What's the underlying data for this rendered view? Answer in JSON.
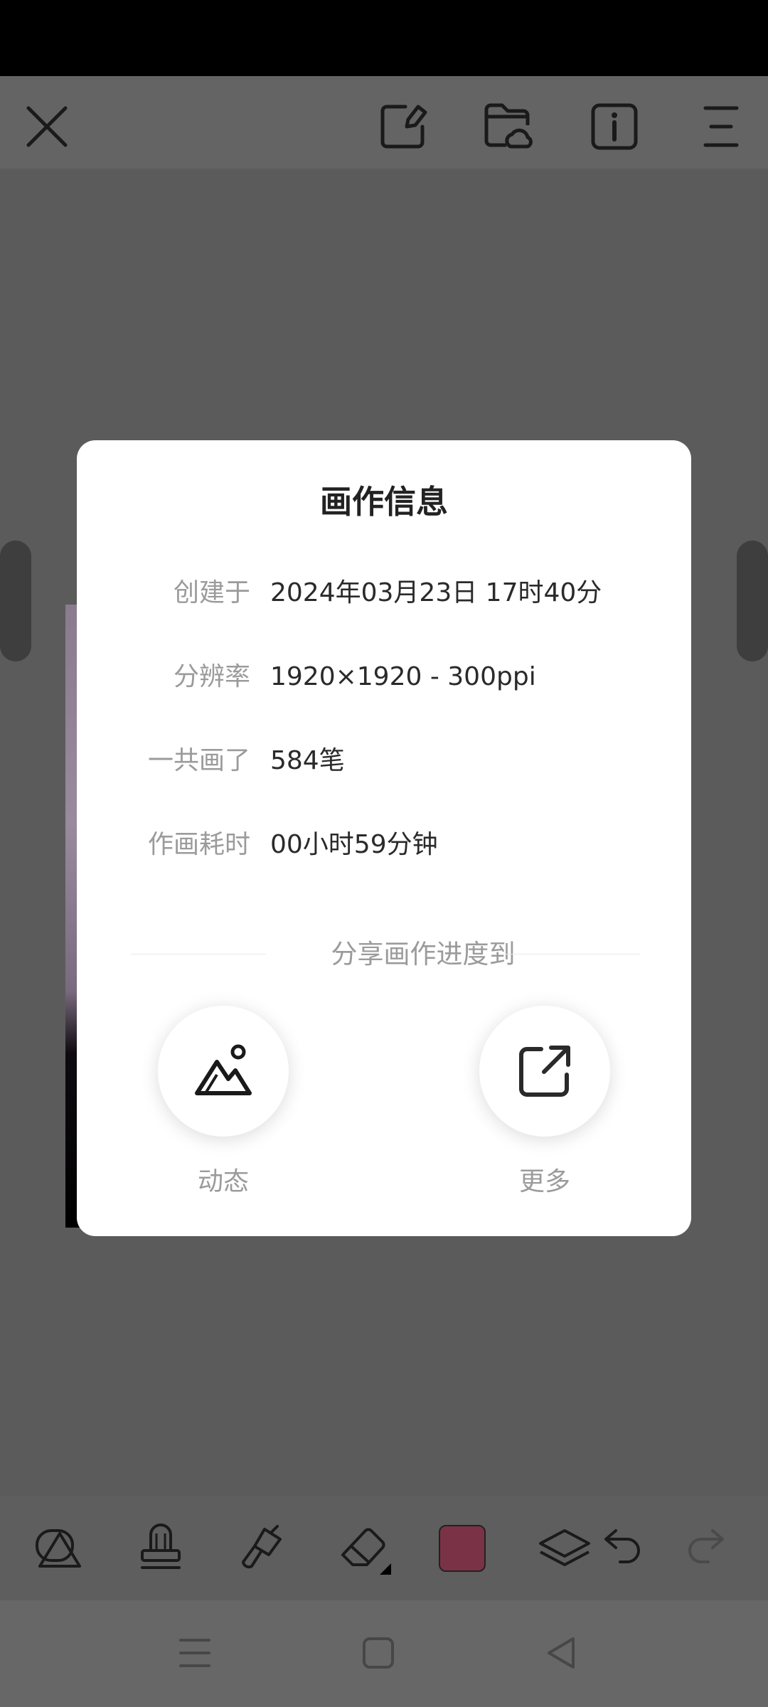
{
  "dialog": {
    "title": "画作信息",
    "rows": [
      {
        "label": "创建于",
        "value": "2024年03月23日 17时40分"
      },
      {
        "label": "分辨率",
        "value": "1920×1920 - 300ppi"
      },
      {
        "label": "一共画了",
        "value": "584笔"
      },
      {
        "label": "作画耗时",
        "value": "00小时59分钟"
      }
    ],
    "share_heading": "分享画作进度到",
    "share_options": [
      {
        "label": "动态",
        "icon": "mountain-image-icon"
      },
      {
        "label": "更多",
        "icon": "external-share-icon"
      }
    ]
  },
  "top_toolbar": {
    "icons": [
      "close-icon",
      "gallery-edit-icon",
      "cloud-folder-icon",
      "info-icon",
      "menu-icon"
    ]
  },
  "bottom_toolbar": {
    "icons": [
      "shapes-icon",
      "stamp-icon",
      "brush-icon",
      "eraser-icon",
      "color-swatch",
      "layers-icon",
      "undo-icon",
      "redo-icon"
    ],
    "current_color": "#7a3346"
  },
  "nav_bar": {
    "icons": [
      "recent-apps-icon",
      "home-icon",
      "back-icon"
    ]
  }
}
